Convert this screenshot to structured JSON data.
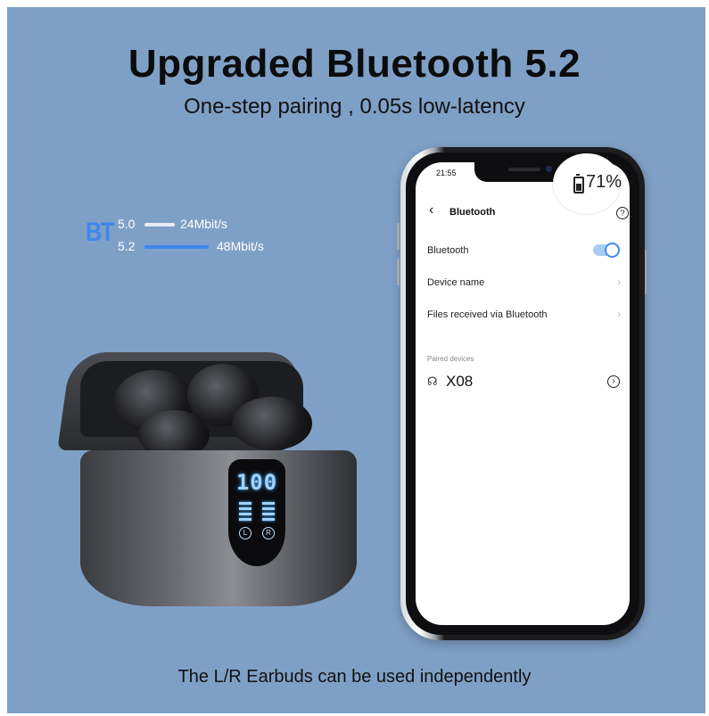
{
  "headline": "Upgraded Bluetooth 5.2",
  "subheadline": "One-step pairing , 0.05s low-latency",
  "footer": "The L/R Earbuds can be used independently",
  "bt_badge": "BT",
  "bt_speeds": [
    {
      "version": "5.0",
      "rate": "24Mbit/s"
    },
    {
      "version": "5.2",
      "rate": "48Mbit/s"
    }
  ],
  "earbuds_case": {
    "display_number": "100",
    "left_label": "L",
    "right_label": "R"
  },
  "phone": {
    "clock": "21:55",
    "battery_percent": "71%",
    "title": "Bluetooth",
    "settings": [
      {
        "label": "Bluetooth"
      },
      {
        "label": "Device name"
      },
      {
        "label": "Files received via Bluetooth"
      }
    ],
    "bluetooth_enabled": true,
    "paired_section_label": "Paired devices",
    "paired_device": "X08"
  },
  "colors": {
    "background": "#7fa0c6",
    "accent_blue": "#3f86ef"
  },
  "icons": [
    "back-chevron-icon",
    "help-icon",
    "toggle-icon",
    "chevron-right-icon",
    "headphones-icon",
    "info-icon",
    "battery-icon"
  ]
}
